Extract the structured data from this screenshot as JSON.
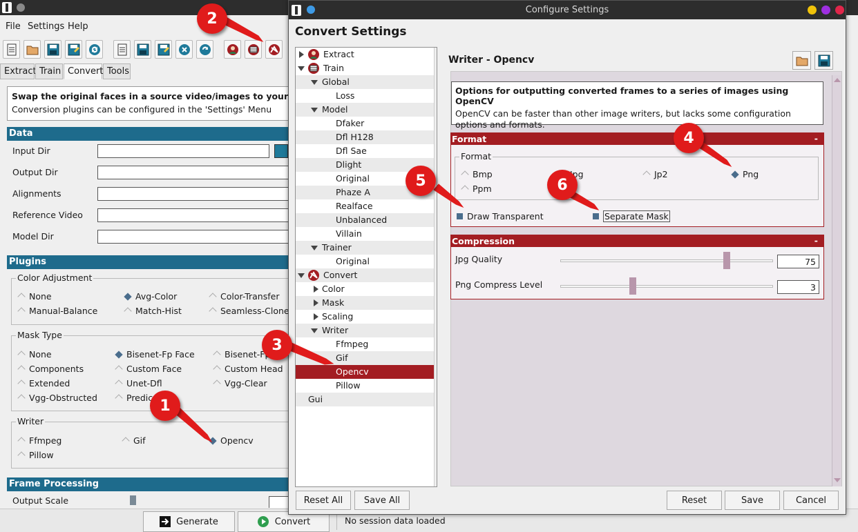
{
  "main": {
    "menu": [
      "File",
      "Settings",
      "Help"
    ],
    "tabs": [
      "Extract",
      "Train",
      "Convert",
      "Tools"
    ],
    "info_title": "Swap the original faces in a source video/images to your final faces",
    "info_sub": "Conversion plugins can be configured in the 'Settings' Menu",
    "data_header": "Data",
    "fields": [
      "Input Dir",
      "Output Dir",
      "Alignments",
      "Reference Video",
      "Model Dir"
    ],
    "plugins_header": "Plugins",
    "color_adjustment": {
      "title": "Color Adjustment",
      "options": [
        "None",
        "Avg-Color",
        "Color-Transfer",
        "Manual-Balance",
        "Match-Hist",
        "Seamless-Clone"
      ]
    },
    "mask_type": {
      "title": "Mask Type",
      "options": [
        "None",
        "Bisenet-Fp Face",
        "Bisenet-Fp",
        "Components",
        "Custom Face",
        "Custom Head",
        "Extended",
        "Unet-Dfl",
        "Vgg-Clear",
        "Vgg-Obstructed",
        "Predic"
      ]
    },
    "writer": {
      "title": "Writer",
      "options": [
        "Ffmpeg",
        "Gif",
        "Opencv",
        "Pillow"
      ]
    },
    "frame_header": "Frame Processing",
    "output_scale_label": "Output Scale",
    "generate_label": "Generate",
    "convert_label": "Convert",
    "status": "No session data loaded"
  },
  "dialog": {
    "window_title": "Configure Settings",
    "heading": "Convert Settings",
    "tree": {
      "extract": "Extract",
      "train": "Train",
      "global": "Global",
      "loss": "Loss",
      "model": "Model",
      "models": [
        "Dfaker",
        "Dfl H128",
        "Dfl Sae",
        "Dlight",
        "Original",
        "Phaze A",
        "Realface",
        "Unbalanced",
        "Villain"
      ],
      "trainer": "Trainer",
      "trainer_original": "Original",
      "convert": "Convert",
      "color": "Color",
      "mask": "Mask",
      "scaling": "Scaling",
      "writer": "Writer",
      "writers": [
        "Ffmpeg",
        "Gif",
        "Opencv",
        "Pillow"
      ],
      "gui": "Gui"
    },
    "writer_title": "Writer - Opencv",
    "desc_title": "Options for outputting converted frames to a series of images using OpenCV",
    "desc_body": "OpenCV can be faster than other image writers, but lacks some configuration options and formats.",
    "format_header": "Format",
    "format_group": "Format",
    "formats": [
      "Bmp",
      "Jpg",
      "Jp2",
      "Png",
      "Ppm"
    ],
    "selected_format": "Png",
    "draw_transparent": "Draw Transparent",
    "separate_mask": "Separate Mask",
    "compression_header": "Compression",
    "jpg_quality_label": "Jpg Quality",
    "jpg_quality_value": "75",
    "jpg_quality": 75,
    "png_level_label": "Png Compress Level",
    "png_level_value": "3",
    "png_level": 3,
    "collapse_symbol": "-",
    "buttons": {
      "reset_all": "Reset All",
      "save_all": "Save All",
      "reset": "Reset",
      "save": "Save",
      "cancel": "Cancel"
    }
  },
  "annotations": [
    "1",
    "2",
    "3",
    "4",
    "5",
    "6"
  ],
  "colors": {
    "accent_red": "#a31d22",
    "section_blue": "#1e6b8c",
    "badge_red": "#e01b1b"
  }
}
